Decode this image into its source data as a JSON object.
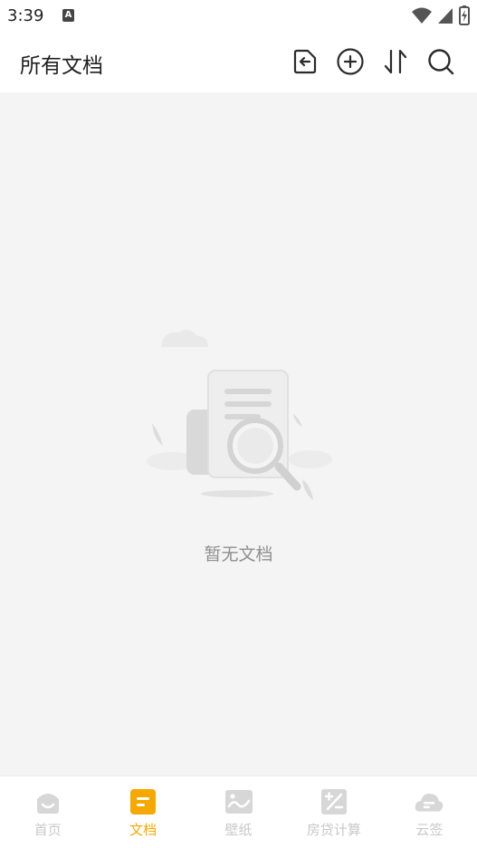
{
  "status_bar": {
    "time": "3:39",
    "notification_icon": "a-icon"
  },
  "header": {
    "title": "所有文档",
    "actions": [
      {
        "name": "import-icon"
      },
      {
        "name": "add-icon"
      },
      {
        "name": "sort-icon"
      },
      {
        "name": "search-icon"
      }
    ]
  },
  "empty_state": {
    "message": "暂无文档"
  },
  "bottom_nav": {
    "items": [
      {
        "label": "首页",
        "icon": "home-icon",
        "active": false
      },
      {
        "label": "文档",
        "icon": "document-icon",
        "active": true
      },
      {
        "label": "壁纸",
        "icon": "wallpaper-icon",
        "active": false
      },
      {
        "label": "房贷计算",
        "icon": "calculator-icon",
        "active": false
      },
      {
        "label": "云签",
        "icon": "cloud-icon",
        "active": false
      }
    ],
    "active_color": "#f5a800",
    "inactive_color": "#c8c8c8"
  }
}
